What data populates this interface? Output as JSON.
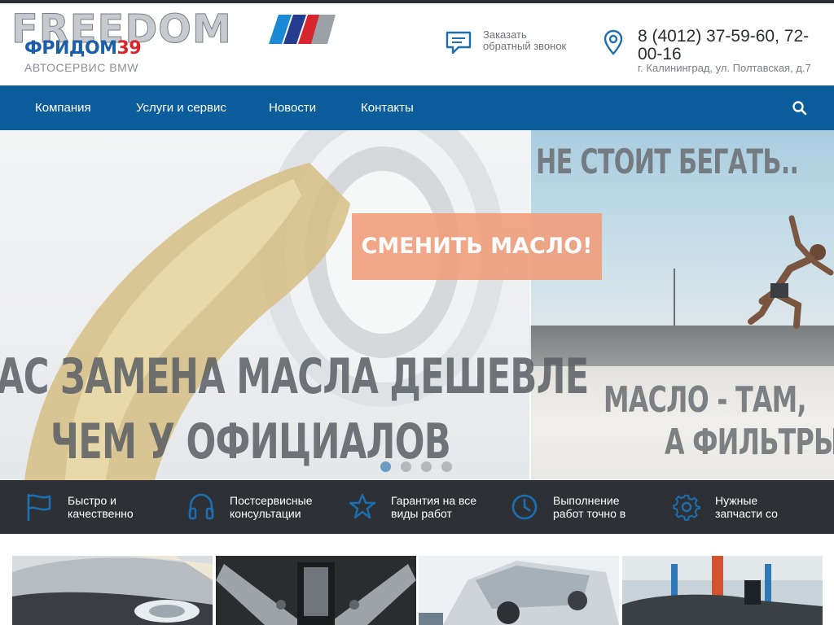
{
  "header": {
    "logo_latin": "FREEDOM",
    "logo_cyrillic": "ФРИДОМ",
    "logo_number": "39",
    "logo_subtitle": "АВТОСЕРВИС BMW",
    "callback_line1": "Заказать",
    "callback_line2": "обратный звонок",
    "phone": "8 (4012) 37-59-60, 72-00-16",
    "address": "г. Калининград, ул. Полтавская, д.7"
  },
  "nav": {
    "items": [
      {
        "label": "Компания"
      },
      {
        "label": "Услуги и сервис"
      },
      {
        "label": "Новости"
      },
      {
        "label": "Контакты"
      }
    ],
    "search_icon": "search-icon"
  },
  "slider": {
    "left_text_line1": "АС ЗАМЕНА МАСЛА ДЕШЕВЛЕ",
    "left_text_line2": "ЧЕМ У ОФИЦИАЛОВ",
    "right_headline": "НЕ СТОИТ БЕГАТЬ..",
    "cta_label": "СМЕНИТЬ МАСЛО!",
    "right_text_line1": "МАСЛО - ТАМ,",
    "right_text_line2": "А ФИЛЬТРЫ",
    "dots_count": 4,
    "active_dot": 1
  },
  "features": [
    {
      "icon": "flag-icon",
      "line1": "Быстро и",
      "line2": "качественно"
    },
    {
      "icon": "headphones-icon",
      "line1": "Постсервисные",
      "line2": "консультации"
    },
    {
      "icon": "star-icon",
      "line1": "Гарантия на все",
      "line2": "виды работ"
    },
    {
      "icon": "clock-icon",
      "line1": "Выполнение",
      "line2": "работ точно в"
    },
    {
      "icon": "gear-icon",
      "line1": "Нужные",
      "line2": "запчасти со"
    }
  ],
  "colors": {
    "nav_bg": "#0c5d9c",
    "accent_blue": "#1b6fb0",
    "features_bg": "#2d3136",
    "cta_bg": "#f0a07e",
    "logo_red": "#d8262d"
  }
}
